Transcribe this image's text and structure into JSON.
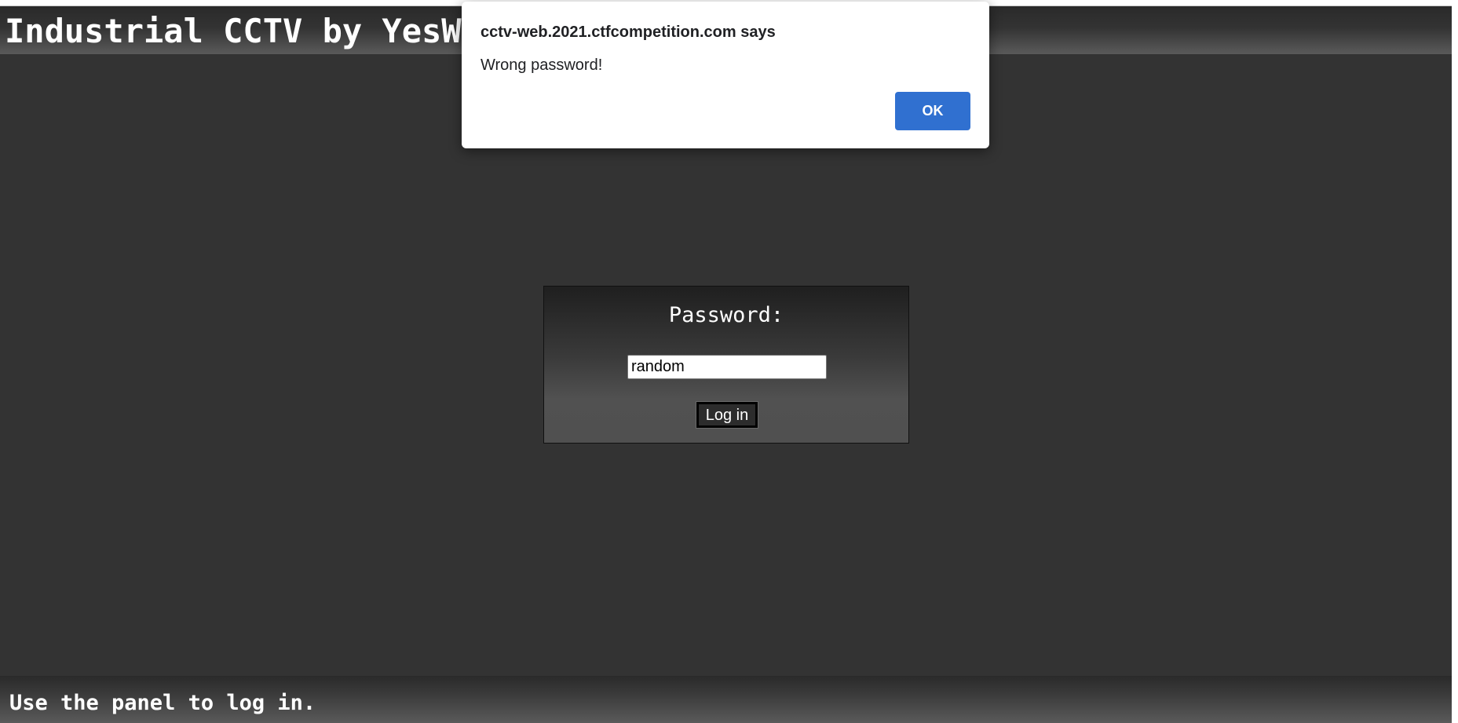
{
  "header": {
    "title": "Industrial CCTV by YesWe"
  },
  "login": {
    "label": "Password:",
    "password_value": "random",
    "button_label": "Log in"
  },
  "footer": {
    "status": "Use the panel to log in."
  },
  "alert": {
    "origin": "cctv-web.2021.ctfcompetition.com says",
    "message": "Wrong password!",
    "ok_label": "OK"
  },
  "colors": {
    "page_background": "#333333",
    "dialog_button": "#3070d0",
    "text": "#ffffff"
  }
}
